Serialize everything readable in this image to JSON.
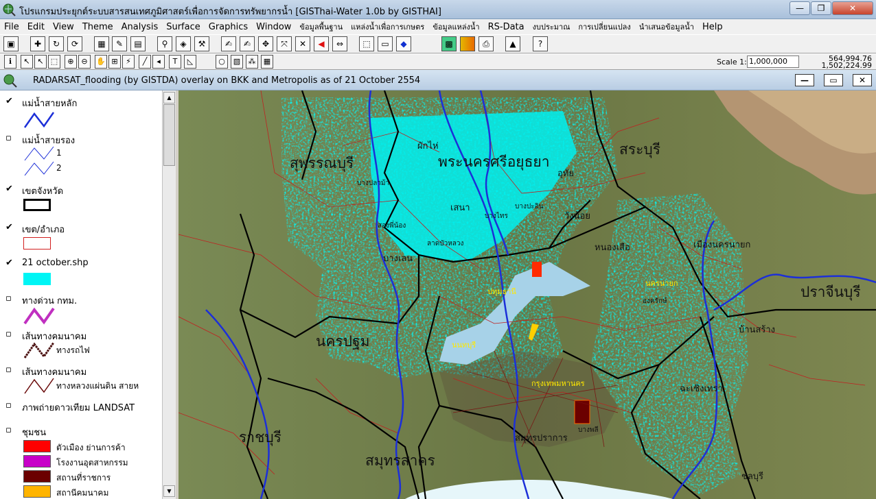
{
  "window": {
    "title": "โปรแกรมประยุกต์ระบบสารสนเทศภูมิศาสตร์เพื่อการจัดการทรัพยากรน้ำ  [GISThai-Water 1.0b   by GISTHAI]",
    "minimize": "—",
    "maximize": "❐",
    "close": "✕"
  },
  "menu": [
    {
      "label": "File",
      "thai": false
    },
    {
      "label": "Edit",
      "thai": false
    },
    {
      "label": "View",
      "thai": false
    },
    {
      "label": "Theme",
      "thai": false
    },
    {
      "label": "Analysis",
      "thai": false
    },
    {
      "label": "Surface",
      "thai": false
    },
    {
      "label": "Graphics",
      "thai": false
    },
    {
      "label": "Window",
      "thai": false
    },
    {
      "label": "ข้อมูลพื้นฐาน",
      "thai": true
    },
    {
      "label": "แหล่งน้ำเพื่อการเกษตร",
      "thai": true
    },
    {
      "label": "ข้อมูลแหล่งน้ำ",
      "thai": true
    },
    {
      "label": "RS-Data",
      "thai": false
    },
    {
      "label": "งบประมาณ",
      "thai": true
    },
    {
      "label": "การเปลี่ยนแปลง",
      "thai": true
    },
    {
      "label": "นำเสนอข้อมูลน้ำ",
      "thai": true
    },
    {
      "label": "Help",
      "thai": false
    }
  ],
  "toolbar": {
    "scale_label": "Scale  1:",
    "scale_value": "1,000,000",
    "coord_x": "564,994.76",
    "coord_y": "1,502,224.99"
  },
  "document": {
    "title": "RADARSAT_flooding (by GISTDA) overlay on BKK and Metropolis as of 21 October 2554",
    "minimize": "—",
    "maximize": "▭",
    "close": "✕"
  },
  "legend": {
    "main_river": {
      "label": "แม่น้ำสายหลัก",
      "checked": true,
      "color": "#1c2fd8"
    },
    "secondary_river": {
      "label": "แม่น้ำสายรอง",
      "checked": false,
      "sub1": "1",
      "sub2": "2",
      "color": "#1c2fd8"
    },
    "province": {
      "label": "เขตจังหวัด",
      "checked": true,
      "color": "#000000"
    },
    "district": {
      "label": "เขต/อำเภอ",
      "checked": true,
      "color": "#d21e1e"
    },
    "flood_shp": {
      "label": "21 october.shp",
      "checked": true,
      "color": "#00f5f5"
    },
    "expressway": {
      "label": "ทางด่วน กทม.",
      "checked": false,
      "color": "#c030c0"
    },
    "railway": {
      "label": "เส้นทางคมนาคม",
      "checked": false,
      "sub": "ทางรถไฟ",
      "color": "#4a1010"
    },
    "highway": {
      "label": "เส้นทางคมนาคม",
      "checked": false,
      "sub": "ทางหลวงแผ่นดิน สายห",
      "color": "#6a0a0a"
    },
    "landsat": {
      "label": "ภาพถ่ายดาวเทียม LANDSAT",
      "checked": false
    },
    "community": {
      "label": "ชุมชน",
      "checked": false,
      "items": [
        {
          "label": "ตัวเมือง ย่านการค้า",
          "color": "#ff0000"
        },
        {
          "label": "โรงงานอุตสาหกรรม",
          "color": "#c800c8"
        },
        {
          "label": "สถานที่ราชการ",
          "color": "#6b0000"
        },
        {
          "label": "สถานีคมนาคม",
          "color": "#ffb400"
        }
      ]
    }
  },
  "map": {
    "provinces": [
      {
        "text": "สุพรรณบุรี",
        "size": "big"
      },
      {
        "text": "พระนครศรีอยุธยา",
        "size": "big"
      },
      {
        "text": "สระบุรี",
        "size": "big"
      },
      {
        "text": "นครปฐม",
        "size": "big"
      },
      {
        "text": "ราชบุรี",
        "size": "big"
      },
      {
        "text": "สมุทรสาคร",
        "size": "big"
      },
      {
        "text": "ปราจีนบุรี",
        "size": "big"
      }
    ],
    "districts": [
      {
        "text": "บางปลาม้า"
      },
      {
        "text": "ผักไห่"
      },
      {
        "text": "บางไทร"
      },
      {
        "text": "เสนา"
      },
      {
        "text": "บางปะอิน"
      },
      {
        "text": "วังน้อย"
      },
      {
        "text": "สองพี่น้อง"
      },
      {
        "text": "ลาดบัวหลวง"
      },
      {
        "text": "บางเลน"
      },
      {
        "text": "หนองเสือ"
      },
      {
        "text": "องครักษ์"
      },
      {
        "text": "เมืองนครนายก"
      },
      {
        "text": "บ้านสร้าง"
      },
      {
        "text": "สมุทรปราการ"
      },
      {
        "text": "ฉะเชิงเทรา"
      },
      {
        "text": "ชลบุรี"
      },
      {
        "text": "อุทัย"
      },
      {
        "text": "บางพลี"
      }
    ],
    "markers": [
      {
        "text": "ปทุมธานี"
      },
      {
        "text": "นนทบุรี"
      },
      {
        "text": "กรุงเทพมหานคร"
      },
      {
        "text": "นครนายก"
      }
    ]
  }
}
